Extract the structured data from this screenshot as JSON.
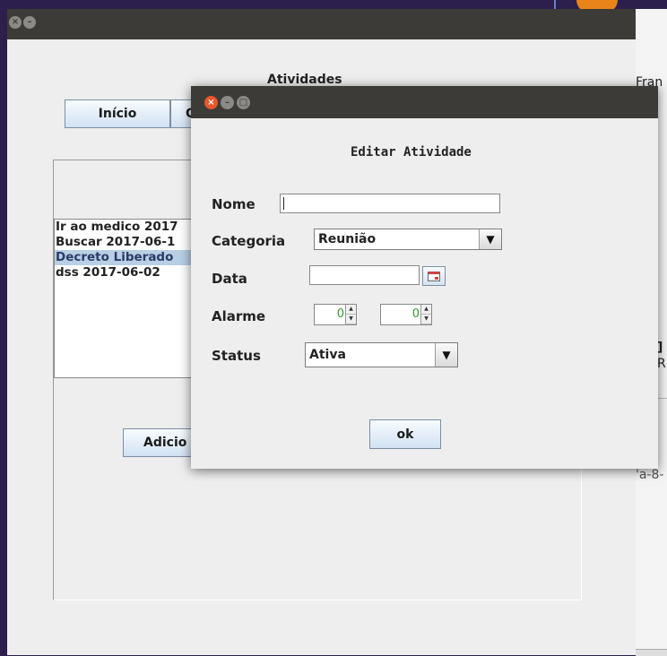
{
  "main_window": {
    "heading": "Atividades",
    "tabs": [
      {
        "label": "Início"
      },
      {
        "label": "C"
      }
    ],
    "activities": [
      {
        "label": "Ir ao medico 2017",
        "selected": false
      },
      {
        "label": "Buscar  2017-06-1",
        "selected": false
      },
      {
        "label": "Decreto Liberado",
        "selected": true
      },
      {
        "label": "dss 2017-06-02",
        "selected": false
      }
    ],
    "add_button_label": "Adicio"
  },
  "background_window": {
    "text_top": "Fran",
    "text_mid1": "]",
    "text_mid2": "R(",
    "text_low": "'a-8-"
  },
  "dialog": {
    "title": "Editar Atividade",
    "nome_label": "Nome",
    "nome_value": "",
    "categoria_label": "Categoria",
    "categoria_value": "Reunião",
    "data_label": "Data",
    "data_value": "",
    "alarme_label": "Alarme",
    "alarme_hour": "0",
    "alarme_minute": "0",
    "status_label": "Status",
    "status_value": "Ativa",
    "ok_label": "ok"
  },
  "colors": {
    "titlebar": "#3d3b38",
    "close_active": "#e8572b",
    "selection": "#b8cfe5",
    "spinner_value": "#2e9c2e"
  }
}
